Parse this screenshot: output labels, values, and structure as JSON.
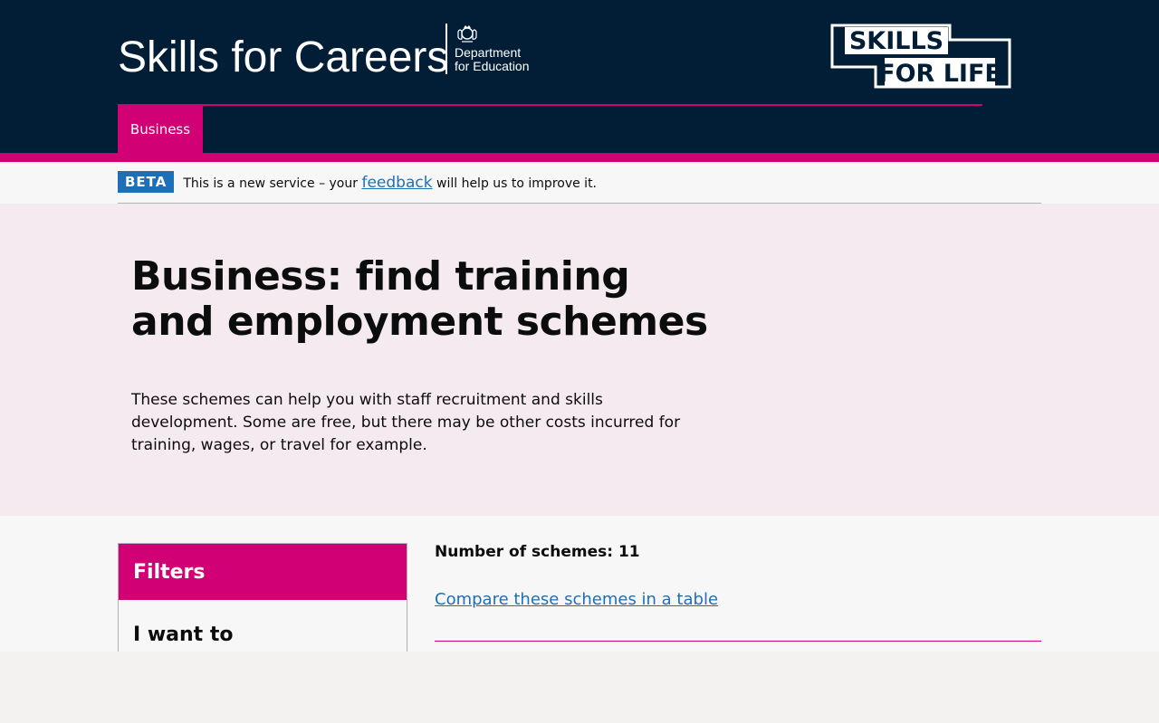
{
  "header": {
    "site_title": "Skills for Careers",
    "dfe_logo_line1": "Department",
    "dfe_logo_line2": "for Education",
    "skills_for_life_line1": "SKILLS",
    "skills_for_life_line2": "FOR LIFE",
    "nav": [
      {
        "label": "Business",
        "active": true
      }
    ]
  },
  "beta_banner": {
    "tag": "BETA",
    "text_before": "This is a new service – your ",
    "link_text": "feedback",
    "text_after": " will help us to improve it."
  },
  "hero": {
    "title": "Business: find training and employment schemes",
    "description": "These schemes can help you with staff recruitment and skills development. Some are free, but there may be other costs incurred for training, wages, or travel for example."
  },
  "filters": {
    "heading": "Filters",
    "subheading": "I want to"
  },
  "results": {
    "count_label": "Number of schemes: 11",
    "compare_link": "Compare these schemes in a table"
  },
  "colors": {
    "header_bg": "#011e36",
    "brand_pink": "#d10074",
    "hero_bg": "#f5eaf0",
    "link": "#1d70b8",
    "beta_tag": "#1d70b8"
  }
}
